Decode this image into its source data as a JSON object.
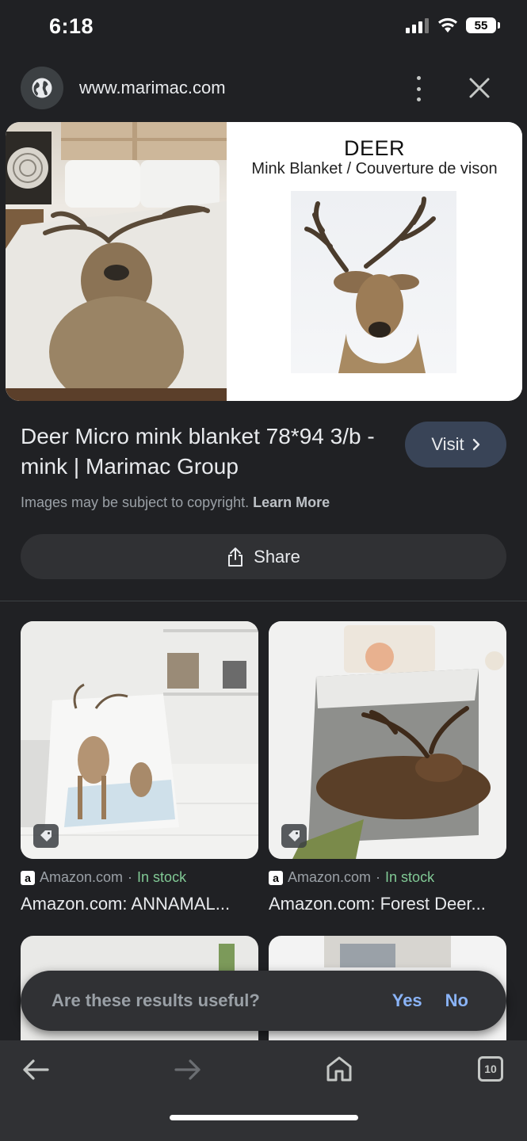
{
  "status_bar": {
    "time": "6:18",
    "battery": "55"
  },
  "url_bar": {
    "url": "www.marimac.com"
  },
  "hero": {
    "title": "DEER",
    "subtitle": "Mink Blanket / Couverture de vison"
  },
  "result": {
    "title": "Deer Micro mink blanket 78*94 3/b - mink | Marimac Group",
    "visit_label": "Visit",
    "copyright_text": "Images may be subject to copyright.",
    "learn_more": "Learn More",
    "share_label": "Share"
  },
  "related": [
    {
      "source": "Amazon.com",
      "separator": "·",
      "availability": "In stock",
      "title": "Amazon.com: ANNAMAL..."
    },
    {
      "source": "Amazon.com",
      "separator": "·",
      "availability": "In stock",
      "title": "Amazon.com: Forest Deer..."
    }
  ],
  "feedback": {
    "question": "Are these results useful?",
    "yes": "Yes",
    "no": "No"
  },
  "toolbar": {
    "tab_count": "10"
  },
  "colors": {
    "background": "#202124",
    "accent": "#8ab4f8",
    "stock": "#81c995",
    "visit_button": "#394457"
  }
}
